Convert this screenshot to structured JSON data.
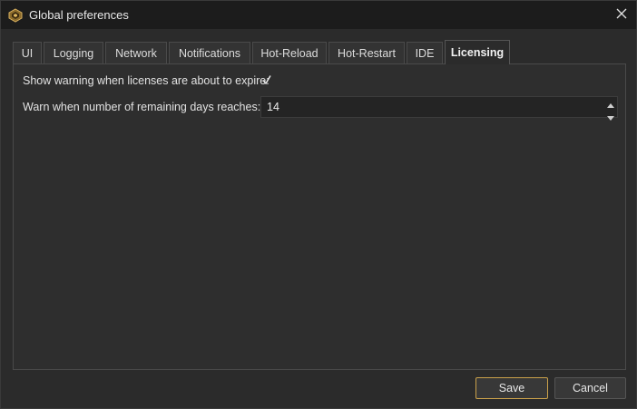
{
  "window": {
    "title": "Global preferences",
    "icon": "app-logo-icon",
    "close_icon": "close-icon"
  },
  "tabs": [
    {
      "label": "UI",
      "active": false
    },
    {
      "label": "Logging",
      "active": false
    },
    {
      "label": "Network",
      "active": false
    },
    {
      "label": "Notifications",
      "active": false
    },
    {
      "label": "Hot-Reload",
      "active": false
    },
    {
      "label": "Hot-Restart",
      "active": false
    },
    {
      "label": "IDE",
      "active": false
    },
    {
      "label": "Licensing",
      "active": true
    }
  ],
  "licensing": {
    "expire_warning_label": "Show warning when licenses are about to expire:",
    "expire_warning_checked": true,
    "days_label": "Warn when number of remaining days reaches:",
    "days_value": "14"
  },
  "buttons": {
    "save": "Save",
    "cancel": "Cancel"
  },
  "colors": {
    "accent": "#c9a04a",
    "background": "#2b2b2b",
    "titlebar": "#1c1c1c"
  }
}
